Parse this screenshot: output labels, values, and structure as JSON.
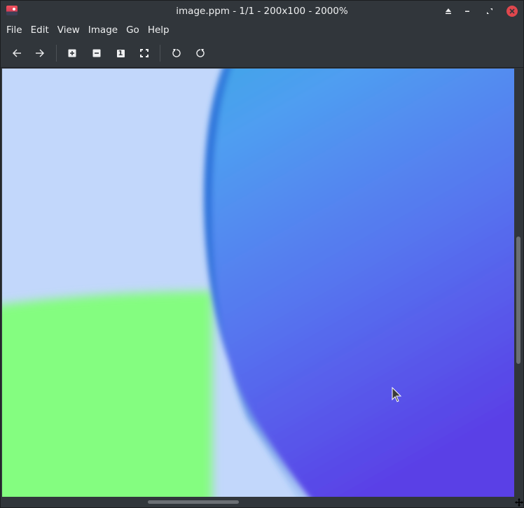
{
  "window": {
    "title": "image.ppm - 1/1 - 200x100 - 2000%"
  },
  "menu": [
    "File",
    "Edit",
    "View",
    "Image",
    "Go",
    "Help"
  ],
  "toolbar": {
    "zoom_original_glyph": "1"
  },
  "colors": {
    "sky": "#c2d7fb",
    "ground": "#84fd80",
    "sphere_top": "#4f9ef1",
    "sphere_bottom": "#5a3fe6",
    "chrome": "#31363b",
    "close_button": "#e0474d"
  },
  "icons": [
    "app-icon",
    "keep-above-icon",
    "minimize-icon",
    "maximize-icon",
    "close-icon",
    "back-arrow-icon",
    "forward-arrow-icon",
    "zoom-in-icon",
    "zoom-out-icon",
    "zoom-original-icon",
    "fit-window-icon",
    "rotate-left-icon",
    "rotate-right-icon",
    "move-cursor-icon",
    "mouse-pointer-icon"
  ]
}
